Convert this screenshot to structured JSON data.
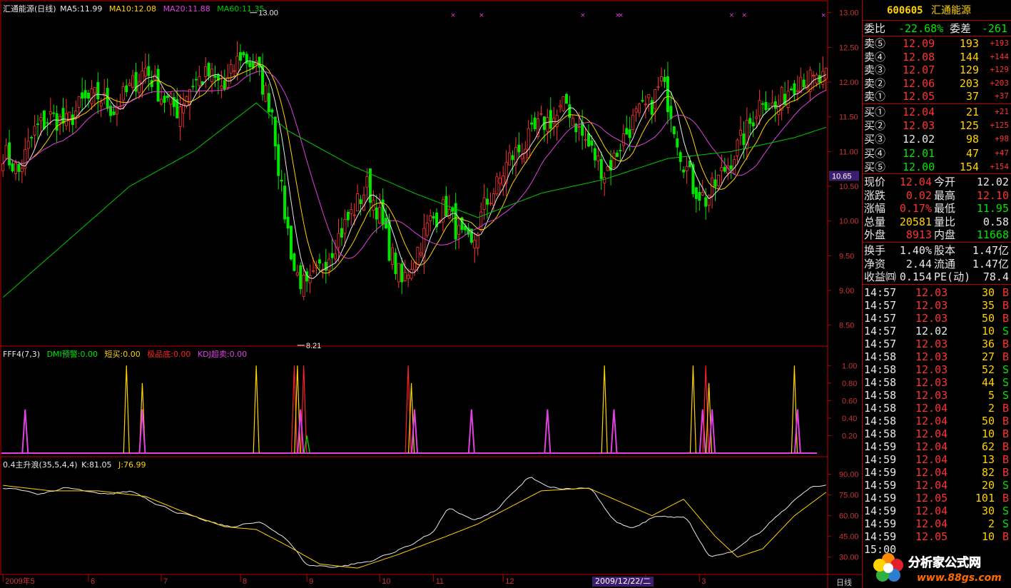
{
  "chart_data": [
    {
      "type": "candlestick",
      "title": "汇通能源(日线)",
      "indicators": [
        {
          "name": "MA5",
          "value": "11.99",
          "color": "#e8e8e8"
        },
        {
          "name": "MA10",
          "value": "12.08",
          "color": "#ffd200"
        },
        {
          "name": "MA20",
          "value": "11.88",
          "color": "#e040e0"
        },
        {
          "name": "MA60",
          "value": "11.35",
          "color": "#00c800"
        }
      ],
      "ylim": [
        8.25,
        13.1
      ],
      "y_ticks": [
        "13.00",
        "12.50",
        "12.00",
        "11.50",
        "11.00",
        "10.50",
        "10.00",
        "9.50",
        "9.00",
        "8.50"
      ],
      "current_price_label": "10.65",
      "high_marker": "13.00",
      "low_marker": "8.21",
      "close_anchors": [
        [
          0,
          11.0
        ],
        [
          5,
          10.7
        ],
        [
          10,
          11.3
        ],
        [
          15,
          11.5
        ],
        [
          20,
          11.4
        ],
        [
          25,
          11.7
        ],
        [
          30,
          11.8
        ],
        [
          35,
          11.6
        ],
        [
          40,
          11.9
        ],
        [
          45,
          12.2
        ],
        [
          50,
          11.8
        ],
        [
          55,
          11.6
        ],
        [
          60,
          12.0
        ],
        [
          65,
          12.1
        ],
        [
          70,
          11.9
        ],
        [
          75,
          12.4
        ],
        [
          80,
          12.2
        ],
        [
          85,
          11.6
        ],
        [
          88,
          10.4
        ],
        [
          92,
          9.3
        ],
        [
          96,
          9.0
        ],
        [
          100,
          9.3
        ],
        [
          105,
          9.7
        ],
        [
          110,
          10.1
        ],
        [
          115,
          10.5
        ],
        [
          118,
          10.2
        ],
        [
          122,
          9.6
        ],
        [
          126,
          9.1
        ],
        [
          130,
          9.5
        ],
        [
          135,
          10.0
        ],
        [
          140,
          10.2
        ],
        [
          144,
          9.8
        ],
        [
          148,
          9.6
        ],
        [
          152,
          10.2
        ],
        [
          156,
          10.5
        ],
        [
          160,
          10.9
        ],
        [
          165,
          11.1
        ],
        [
          170,
          11.4
        ],
        [
          175,
          11.5
        ],
        [
          178,
          11.7
        ],
        [
          182,
          11.3
        ],
        [
          186,
          11.0
        ],
        [
          190,
          10.7
        ],
        [
          193,
          10.9
        ],
        [
          196,
          11.2
        ],
        [
          200,
          11.5
        ],
        [
          205,
          11.7
        ],
        [
          208,
          12.0
        ],
        [
          211,
          11.6
        ],
        [
          214,
          11.0
        ],
        [
          218,
          10.5
        ],
        [
          222,
          10.3
        ],
        [
          226,
          10.6
        ],
        [
          230,
          10.9
        ],
        [
          235,
          11.3
        ],
        [
          240,
          11.8
        ],
        [
          244,
          11.6
        ],
        [
          248,
          11.9
        ],
        [
          252,
          12.1
        ],
        [
          256,
          12.0
        ],
        [
          260,
          12.04
        ]
      ],
      "ma60_anchors": [
        [
          0,
          8.9
        ],
        [
          20,
          9.7
        ],
        [
          40,
          10.5
        ],
        [
          60,
          11.0
        ],
        [
          80,
          11.7
        ],
        [
          90,
          11.3
        ],
        [
          110,
          10.8
        ],
        [
          130,
          10.4
        ],
        [
          150,
          10.05
        ],
        [
          170,
          10.4
        ],
        [
          190,
          10.6
        ],
        [
          210,
          10.9
        ],
        [
          230,
          11.0
        ],
        [
          250,
          11.2
        ],
        [
          260,
          11.35
        ]
      ],
      "top_markers": [
        142,
        151,
        183,
        194,
        195,
        230,
        234,
        259
      ]
    },
    {
      "type": "line",
      "title": "FFF4(7,3)",
      "series": [
        {
          "name": "DMI预警",
          "value": "0.00",
          "color": "#00e600"
        },
        {
          "name": "短买",
          "value": "0.00",
          "color": "#ffd200"
        },
        {
          "name": "极品底",
          "value": "0.00",
          "color": "#ff2020"
        },
        {
          "name": "KDJ超卖",
          "value": "0.00",
          "color": "#e040e0"
        }
      ],
      "y_ticks": [
        "1.00",
        "0.80",
        "0.60",
        "0.40",
        "0.20"
      ],
      "ylim": [
        0,
        1.1
      ],
      "spikes": [
        {
          "x": 7,
          "h": 0.5,
          "s": 3
        },
        {
          "x": 39,
          "h": 1.0,
          "s": 1
        },
        {
          "x": 44,
          "h": 0.8,
          "s": 1
        },
        {
          "x": 44,
          "h": 0.5,
          "s": 3
        },
        {
          "x": 80,
          "h": 1.0,
          "s": 1
        },
        {
          "x": 92,
          "h": 1.0,
          "s": 2
        },
        {
          "x": 95,
          "h": 1.0,
          "s": 2
        },
        {
          "x": 93,
          "h": 1.0,
          "s": 1
        },
        {
          "x": 94,
          "h": 0.5,
          "s": 3
        },
        {
          "x": 96,
          "h": 0.2,
          "s": 0
        },
        {
          "x": 128,
          "h": 1.0,
          "s": 2
        },
        {
          "x": 129,
          "h": 0.8,
          "s": 1
        },
        {
          "x": 130,
          "h": 0.5,
          "s": 3
        },
        {
          "x": 148,
          "h": 0.5,
          "s": 3
        },
        {
          "x": 172,
          "h": 0.5,
          "s": 3
        },
        {
          "x": 190,
          "h": 1.0,
          "s": 1
        },
        {
          "x": 193,
          "h": 0.5,
          "s": 3
        },
        {
          "x": 218,
          "h": 1.0,
          "s": 1
        },
        {
          "x": 221,
          "h": 0.5,
          "s": 3
        },
        {
          "x": 222,
          "h": 1.0,
          "s": 2
        },
        {
          "x": 223,
          "h": 0.8,
          "s": 1
        },
        {
          "x": 224,
          "h": 0.5,
          "s": 3
        },
        {
          "x": 250,
          "h": 1.0,
          "s": 1
        },
        {
          "x": 251,
          "h": 0.5,
          "s": 3
        }
      ]
    },
    {
      "type": "line",
      "title": "0.4主升浪(35,5,4,4)",
      "series": [
        {
          "name": "K",
          "value": "81.05",
          "color": "#e8e8e8"
        },
        {
          "name": "J",
          "value": "76.99",
          "color": "#ffd200"
        }
      ],
      "y_ticks": [
        "90.00",
        "75.00",
        "60.00",
        "45.00",
        "30.00"
      ],
      "ylim": [
        20,
        95
      ],
      "k_anchors": [
        [
          0,
          80
        ],
        [
          10,
          76
        ],
        [
          20,
          80
        ],
        [
          30,
          75
        ],
        [
          40,
          78
        ],
        [
          50,
          66
        ],
        [
          60,
          58
        ],
        [
          70,
          52
        ],
        [
          80,
          55
        ],
        [
          88,
          45
        ],
        [
          95,
          24
        ],
        [
          105,
          23
        ],
        [
          115,
          27
        ],
        [
          125,
          36
        ],
        [
          135,
          48
        ],
        [
          140,
          66
        ],
        [
          148,
          56
        ],
        [
          155,
          64
        ],
        [
          165,
          88
        ],
        [
          172,
          80
        ],
        [
          185,
          80
        ],
        [
          192,
          56
        ],
        [
          198,
          50
        ],
        [
          205,
          60
        ],
        [
          215,
          58
        ],
        [
          222,
          30
        ],
        [
          230,
          34
        ],
        [
          240,
          52
        ],
        [
          250,
          74
        ],
        [
          255,
          82
        ],
        [
          260,
          81
        ]
      ],
      "j_anchors": [
        [
          0,
          82
        ],
        [
          15,
          78
        ],
        [
          30,
          78
        ],
        [
          45,
          74
        ],
        [
          60,
          60
        ],
        [
          70,
          52
        ],
        [
          80,
          50
        ],
        [
          90,
          38
        ],
        [
          100,
          25
        ],
        [
          112,
          22
        ],
        [
          125,
          32
        ],
        [
          140,
          45
        ],
        [
          150,
          54
        ],
        [
          160,
          66
        ],
        [
          170,
          78
        ],
        [
          185,
          80
        ],
        [
          195,
          70
        ],
        [
          205,
          60
        ],
        [
          215,
          72
        ],
        [
          225,
          45
        ],
        [
          232,
          30
        ],
        [
          240,
          36
        ],
        [
          250,
          60
        ],
        [
          260,
          77
        ]
      ]
    }
  ],
  "x_axis": {
    "months": [
      {
        "label": "2009年5",
        "i": 0
      },
      {
        "label": "6",
        "i": 27
      },
      {
        "label": "7",
        "i": 50
      },
      {
        "label": "8",
        "i": 75
      },
      {
        "label": "9",
        "i": 96
      },
      {
        "label": "10",
        "i": 119
      },
      {
        "label": "11",
        "i": 136
      },
      {
        "label": "12",
        "i": 158
      },
      {
        "label": "2",
        "i": 203
      },
      {
        "label": "3",
        "i": 220
      }
    ],
    "cursor_date": "2009/12/22/二",
    "period": "日线"
  },
  "quote": {
    "code": "600605",
    "name": "汇通能源",
    "wei_bi_label": "委比",
    "wei_bi": "-22.68%",
    "wei_cha_label": "委差",
    "wei_cha": "-261",
    "asks": [
      {
        "label": "卖⑤",
        "price": "12.09",
        "vol": "193",
        "chg": "+193",
        "pc": "cr"
      },
      {
        "label": "卖④",
        "price": "12.08",
        "vol": "144",
        "chg": "+144",
        "pc": "cr"
      },
      {
        "label": "卖③",
        "price": "12.07",
        "vol": "129",
        "chg": "+129",
        "pc": "cr"
      },
      {
        "label": "卖②",
        "price": "12.06",
        "vol": "203",
        "chg": "+203",
        "pc": "cr"
      },
      {
        "label": "卖①",
        "price": "12.05",
        "vol": "37",
        "chg": "+37",
        "pc": "cr"
      }
    ],
    "bids": [
      {
        "label": "买①",
        "price": "12.04",
        "vol": "21",
        "chg": "+21",
        "pc": "cr"
      },
      {
        "label": "买②",
        "price": "12.03",
        "vol": "125",
        "chg": "+125",
        "pc": "cr"
      },
      {
        "label": "买③",
        "price": "12.02",
        "vol": "98",
        "chg": "+98",
        "pc": "cw"
      },
      {
        "label": "买④",
        "price": "12.01",
        "vol": "47",
        "chg": "+47",
        "pc": "cg"
      },
      {
        "label": "买⑤",
        "price": "12.00",
        "vol": "154",
        "chg": "+154",
        "pc": "cg"
      }
    ],
    "stats": [
      {
        "l1": "现价",
        "v1": "12.04",
        "c1": "cr",
        "l2": "今开",
        "v2": "12.02",
        "c2": "cw"
      },
      {
        "l1": "涨跌",
        "v1": "0.02",
        "c1": "cr",
        "l2": "最高",
        "v2": "12.10",
        "c2": "cr"
      },
      {
        "l1": "涨幅",
        "v1": "0.17%",
        "c1": "cr",
        "l2": "最低",
        "v2": "11.95",
        "c2": "cg"
      },
      {
        "l1": "总量",
        "v1": "20581",
        "c1": "cy",
        "l2": "量比",
        "v2": "0.58",
        "c2": "cw"
      },
      {
        "l1": "外盘",
        "v1": "8913",
        "c1": "cr",
        "l2": "内盘",
        "v2": "11668",
        "c2": "cg"
      }
    ],
    "stats2": [
      {
        "l1": "换手",
        "v1": "1.40%",
        "c1": "cw",
        "l2": "股本",
        "v2": "1.47亿",
        "c2": "cw"
      },
      {
        "l1": "净资",
        "v1": "2.44",
        "c1": "cw",
        "l2": "流通",
        "v2": "1.47亿",
        "c2": "cw"
      },
      {
        "l1": "收益㈣",
        "v1": "0.154",
        "c1": "cw",
        "l2": "PE(动)",
        "v2": "78.4",
        "c2": "cw"
      }
    ],
    "ticks": [
      {
        "t": "14:57",
        "p": "12.03",
        "pc": "cr",
        "v": "30",
        "s": "B"
      },
      {
        "t": "14:57",
        "p": "12.03",
        "pc": "cr",
        "v": "35",
        "s": "B"
      },
      {
        "t": "14:57",
        "p": "12.03",
        "pc": "cr",
        "v": "50",
        "s": "B"
      },
      {
        "t": "14:57",
        "p": "12.02",
        "pc": "cw",
        "v": "10",
        "s": "S"
      },
      {
        "t": "14:57",
        "p": "12.03",
        "pc": "cr",
        "v": "36",
        "s": "B"
      },
      {
        "t": "14:58",
        "p": "12.03",
        "pc": "cr",
        "v": "27",
        "s": "B"
      },
      {
        "t": "14:58",
        "p": "12.03",
        "pc": "cr",
        "v": "52",
        "s": "S"
      },
      {
        "t": "14:58",
        "p": "12.03",
        "pc": "cr",
        "v": "44",
        "s": "S"
      },
      {
        "t": "14:58",
        "p": "12.03",
        "pc": "cr",
        "v": "5",
        "s": "S"
      },
      {
        "t": "14:58",
        "p": "12.04",
        "pc": "cr",
        "v": "2",
        "s": "B"
      },
      {
        "t": "14:58",
        "p": "12.04",
        "pc": "cr",
        "v": "50",
        "s": "B"
      },
      {
        "t": "14:58",
        "p": "12.04",
        "pc": "cr",
        "v": "10",
        "s": "B"
      },
      {
        "t": "14:59",
        "p": "12.04",
        "pc": "cr",
        "v": "62",
        "s": "B"
      },
      {
        "t": "14:59",
        "p": "12.04",
        "pc": "cr",
        "v": "13",
        "s": "B"
      },
      {
        "t": "14:59",
        "p": "12.04",
        "pc": "cr",
        "v": "82",
        "s": "B"
      },
      {
        "t": "14:59",
        "p": "12.04",
        "pc": "cr",
        "v": "20",
        "s": "S"
      },
      {
        "t": "14:59",
        "p": "12.05",
        "pc": "cr",
        "v": "101",
        "s": "B"
      },
      {
        "t": "14:59",
        "p": "12.04",
        "pc": "cr",
        "v": "30",
        "s": "S"
      },
      {
        "t": "14:59",
        "p": "12.04",
        "pc": "cr",
        "v": "2",
        "s": "S"
      },
      {
        "t": "14:59",
        "p": "12.05",
        "pc": "cr",
        "v": "10",
        "s": "B"
      },
      {
        "t": "15:00",
        "p": "",
        "pc": "cr",
        "v": "",
        "s": ""
      }
    ]
  },
  "watermark": {
    "title": "分析家公式网",
    "url": "www.88gs.com"
  }
}
